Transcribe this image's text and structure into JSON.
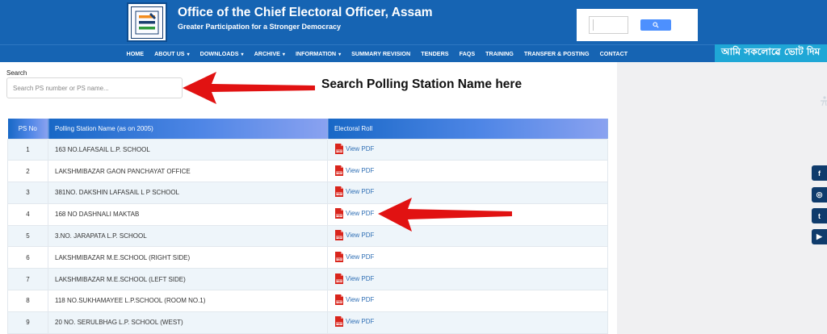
{
  "header": {
    "title": "Office of the Chief Electoral Officer, Assam",
    "subtitle": "Greater Participation for a Stronger Democracy",
    "logo_icon": "election-commission-logo-icon",
    "search_button_icon": "search-icon"
  },
  "nav": {
    "items": [
      {
        "label": "HOME",
        "dropdown": false
      },
      {
        "label": "ABOUT US",
        "dropdown": true
      },
      {
        "label": "DOWNLOADS",
        "dropdown": true
      },
      {
        "label": "ARCHIVE",
        "dropdown": true
      },
      {
        "label": "INFORMATION",
        "dropdown": true
      },
      {
        "label": "SUMMARY REVISION",
        "dropdown": false
      },
      {
        "label": "TENDERS",
        "dropdown": false
      },
      {
        "label": "FAQS",
        "dropdown": false
      },
      {
        "label": "TRAINING",
        "dropdown": false
      },
      {
        "label": "TRANSFER & POSTING",
        "dropdown": false
      },
      {
        "label": "CONTACT",
        "dropdown": false
      }
    ],
    "chevron": "▾",
    "slogan": "আমি সকলোৱে ভোট দিম"
  },
  "search": {
    "label": "Search",
    "placeholder": "Search PS number or PS name...",
    "value": ""
  },
  "annotation": {
    "text": "Search Polling Station Name here"
  },
  "table": {
    "columns": [
      "PS No",
      "Polling Station Name (as on 2005)",
      "Electoral Roll"
    ],
    "link_label": "View PDF",
    "rows": [
      {
        "ps_no": "1",
        "name": "163 NO.LAFASAIL L.P. SCHOOL"
      },
      {
        "ps_no": "2",
        "name": "LAKSHMIBAZAR GAON PANCHAYAT OFFICE"
      },
      {
        "ps_no": "3",
        "name": "381NO. DAKSHIN LAFASAIL L P SCHOOL"
      },
      {
        "ps_no": "4",
        "name": "168 NO DASHNALI MAKTAB"
      },
      {
        "ps_no": "5",
        "name": "3.NO. JARAPATA L.P. SCHOOL"
      },
      {
        "ps_no": "6",
        "name": "LAKSHMIBAZAR M.E.SCHOOL (RIGHT SIDE)"
      },
      {
        "ps_no": "7",
        "name": "LAKSHMIBAZAR M.E.SCHOOL (LEFT SIDE)"
      },
      {
        "ps_no": "8",
        "name": "118 NO.SUKHAMAYEE L.P.SCHOOL (ROOM NO.1)"
      },
      {
        "ps_no": "9",
        "name": "20 NO. SERULBHAG L.P. SCHOOL (WEST)"
      }
    ]
  },
  "social": [
    {
      "name": "facebook-icon",
      "glyph": "f"
    },
    {
      "name": "instagram-icon",
      "glyph": "◎"
    },
    {
      "name": "twitter-icon",
      "glyph": "t"
    },
    {
      "name": "youtube-icon",
      "glyph": "▶"
    }
  ],
  "colors": {
    "header_blue": "#1664b3",
    "slogan_cyan": "#1fa7d6",
    "arrow_red": "#e11212",
    "link_blue": "#2f6fb5",
    "pdf_red": "#d9251c"
  }
}
